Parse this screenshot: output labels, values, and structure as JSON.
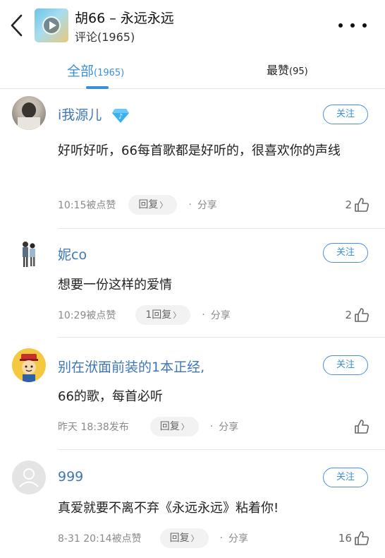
{
  "header": {
    "song_title": "胡66 – 永远永远",
    "subtitle": "评论(1965)",
    "back_icon": "chevron-left-icon",
    "more_icon": "more-horizontal-icon"
  },
  "tabs": {
    "all_label": "全部",
    "all_count": "(1965)",
    "best_label": "最赞",
    "best_count": "(95)"
  },
  "colors": {
    "accent": "#3a8fd9",
    "username": "#3e77b8",
    "vip": "#3ab0f0"
  },
  "follow_label": "关注",
  "share_label": "分享",
  "comments": [
    {
      "username": "i我源儿",
      "text": "好听好听，66每首歌都是好听的，很喜欢你的声线",
      "time": "10:15被点赞",
      "reply_label": "回复",
      "likes": "2",
      "has_vip": true
    },
    {
      "username": "妮co",
      "text": "想要一份这样的爱情",
      "time": "10:29被点赞",
      "reply_label": "1回复",
      "likes": "2",
      "has_vip": false
    },
    {
      "username": "别在洑面前装的1本正经,",
      "text": "66的歌，每首必听",
      "time": "昨天 18:38发布",
      "reply_label": "回复",
      "likes": "",
      "has_vip": false
    },
    {
      "username": "999",
      "text": "真爱就要不离不弃《永远永远》粘着你!",
      "time": "8-31 20:14被点赞",
      "reply_label": "回复",
      "likes": "16",
      "has_vip": false
    }
  ]
}
